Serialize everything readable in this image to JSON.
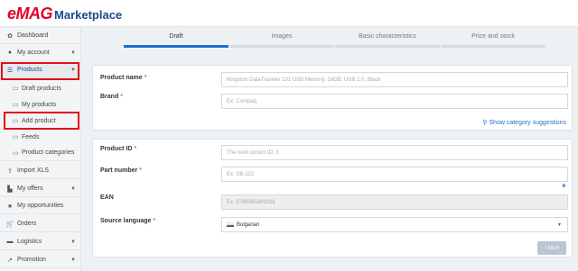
{
  "brand": {
    "part1": "eMAG",
    "part2": "Marketplace"
  },
  "sidebar": {
    "dashboard": "Dashboard",
    "my_account": "My account",
    "products": "Products",
    "draft_products": "Draft products",
    "my_products": "My products",
    "add_product": "Add product",
    "feeds": "Feeds",
    "product_categories": "Product categories",
    "import_xls": "Import XLS",
    "my_offers": "My offers",
    "my_opportunities": "My opportunities",
    "orders": "Orders",
    "logistics": "Logistics",
    "promotion": "Promotion"
  },
  "steps": [
    {
      "label": "Draft"
    },
    {
      "label": "Images"
    },
    {
      "label": "Basic characteristics"
    },
    {
      "label": "Price and stock"
    }
  ],
  "form1": {
    "product_name_label": "Product name",
    "product_name_placeholder": "Kingston DataTraveler 101 USB Memory, 16GB, USB 2.0, Black",
    "brand_label": "Brand",
    "brand_placeholder": "Ex: Compaq",
    "suggest_link": "Show category suggestions"
  },
  "form2": {
    "product_id_label": "Product ID",
    "product_id_placeholder": "The next correct ID: 3",
    "part_number_label": "Part number",
    "part_number_placeholder": "Ex: SB-122",
    "ean_label": "EAN",
    "ean_placeholder": "Ex: 9786065889026",
    "source_language_label": "Source language",
    "source_language_value": "Bulgarian"
  },
  "required_mark": "*",
  "next_button": "Next",
  "colors": {
    "brand_red": "#e4002b",
    "brand_blue": "#1a4a8a",
    "accent": "#1d6fcf",
    "highlight": "#e00d1a",
    "required": "#e8730c"
  }
}
